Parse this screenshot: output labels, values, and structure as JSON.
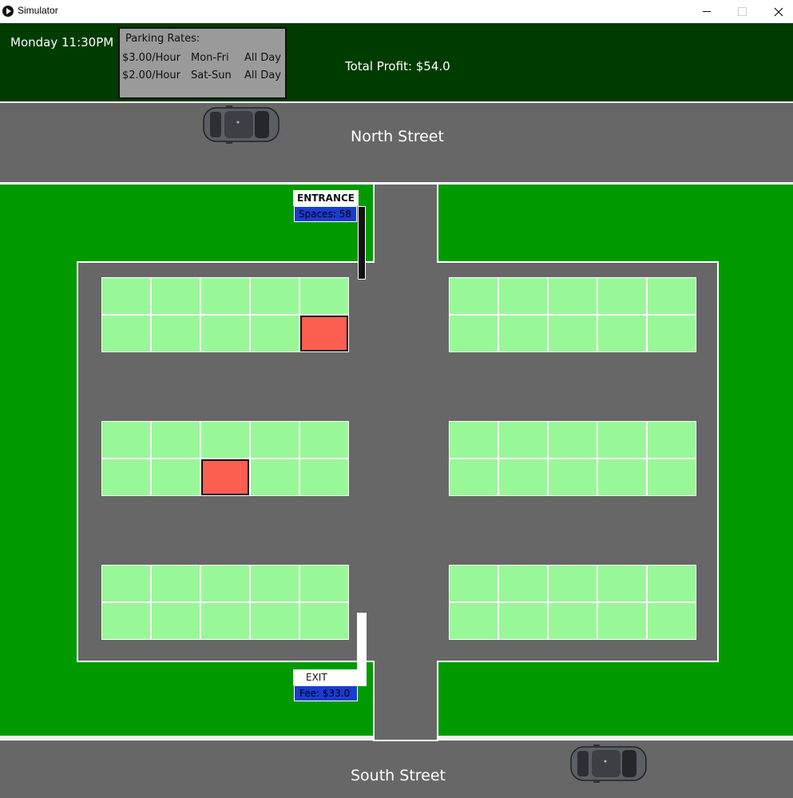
{
  "window": {
    "title": "Simulator",
    "controls": [
      "minimize",
      "maximize",
      "close"
    ]
  },
  "header": {
    "clock": "Monday 11:30PM",
    "rates": {
      "title": "Parking Rates:",
      "rows": [
        {
          "price": "$3.00/Hour",
          "days": "Mon-Fri",
          "period": "All Day"
        },
        {
          "price": "$2.00/Hour",
          "days": "Sat-Sun",
          "period": "All Day"
        }
      ]
    },
    "total_profit": "Total Profit: $54.0"
  },
  "streets": {
    "north": "North Street",
    "south": "South Street"
  },
  "entrance": {
    "label": "ENTRANCE",
    "spaces": "Spaces: 58"
  },
  "exit": {
    "label": "EXIT",
    "fee": "Fee: $33.0"
  },
  "lot": {
    "blocks": [
      {
        "id": "top-left",
        "rows": 2,
        "cols": 5,
        "occupied": [
          [
            1,
            4
          ]
        ]
      },
      {
        "id": "top-right",
        "rows": 2,
        "cols": 5,
        "occupied": []
      },
      {
        "id": "middle-left",
        "rows": 2,
        "cols": 5,
        "occupied": [
          [
            1,
            2
          ]
        ]
      },
      {
        "id": "middle-right",
        "rows": 2,
        "cols": 5,
        "occupied": []
      },
      {
        "id": "bottom-left",
        "rows": 2,
        "cols": 5,
        "occupied": []
      },
      {
        "id": "bottom-right",
        "rows": 2,
        "cols": 5,
        "occupied": []
      }
    ]
  },
  "cars": [
    {
      "id": "car-north",
      "street": "north",
      "direction": "right"
    },
    {
      "id": "car-south",
      "street": "south",
      "direction": "right"
    }
  ],
  "colors": {
    "header_bg": "#003b00",
    "lawn": "#009a00",
    "asphalt": "#676767",
    "spot_free": "#98f898",
    "spot_occupied": "#fa5f4f",
    "label_blue": "#1a3cd0"
  }
}
